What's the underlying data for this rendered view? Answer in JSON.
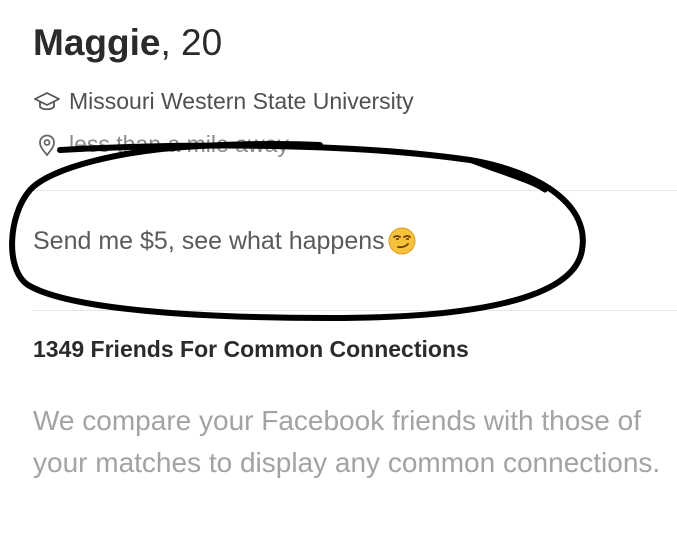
{
  "profile": {
    "name": "Maggie",
    "age_text": ", 20",
    "school": "Missouri Western State University",
    "distance": "less than a mile away",
    "bio": "Send me $5, see what happens",
    "bio_emoji": "smirking-face-emoji"
  },
  "connections": {
    "title": "1349 Friends For Common Connections",
    "description": "We compare your Facebook friends with those of your matches to display any common connections."
  },
  "icons": {
    "school": "graduation-cap-icon",
    "distance": "location-pin-icon"
  },
  "colors": {
    "annotation_ink": "#000000",
    "emoji_face": "#f7c23b"
  }
}
